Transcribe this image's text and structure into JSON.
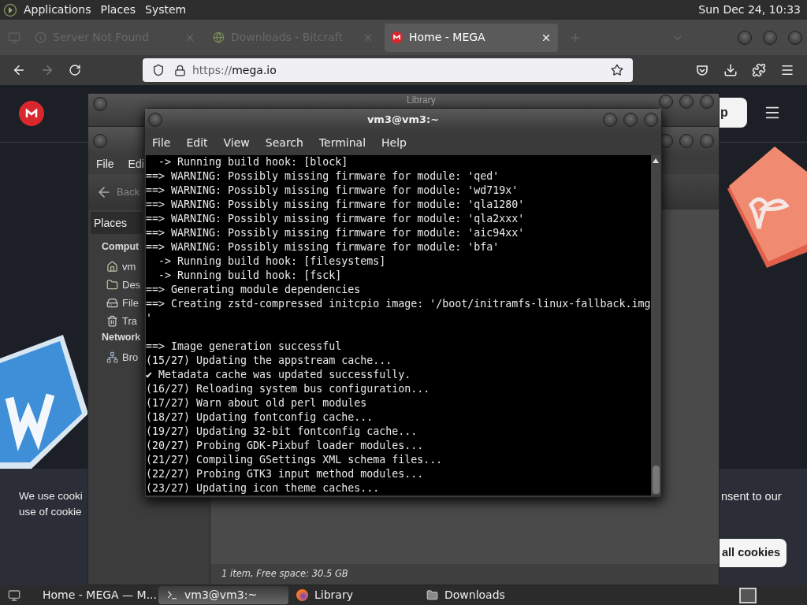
{
  "top_panel": {
    "menus": [
      "Applications",
      "Places",
      "System"
    ],
    "clock": "Sun Dec 24, 10:33"
  },
  "browser": {
    "tabs": [
      {
        "title": "Server Not Found",
        "kind": "info",
        "selected": false
      },
      {
        "title": "Downloads - Bitcraft",
        "kind": "site",
        "selected": false
      },
      {
        "title": "Home - MEGA",
        "kind": "mega",
        "selected": true
      }
    ],
    "forward_disabled": true,
    "url_scheme": "https://",
    "url_host": "mega.io"
  },
  "page": {
    "header_button": "p",
    "cookie_left": [
      "We use cooki",
      "use of cookie"
    ],
    "cookie_right": "nsent to our",
    "cookie_button": "all cookies"
  },
  "library_window": {
    "title": "Library"
  },
  "file_manager": {
    "menus": [
      "File",
      "Edi"
    ],
    "back": "Back",
    "sidebar_header": "Places",
    "sections": [
      {
        "title": "Comput",
        "items": [
          {
            "label": "vm",
            "kind": "home"
          },
          {
            "label": "Des",
            "kind": "desktop"
          },
          {
            "label": "File",
            "kind": "drive"
          },
          {
            "label": "Tra",
            "kind": "trash"
          }
        ]
      },
      {
        "title": "Network",
        "items": [
          {
            "label": "Bro",
            "kind": "network"
          }
        ]
      }
    ],
    "status": "1 item, Free space: 30.5 GB"
  },
  "terminal": {
    "title": "vm3@vm3:~",
    "menus": [
      "File",
      "Edit",
      "View",
      "Search",
      "Terminal",
      "Help"
    ],
    "blocks": [
      [
        "  -> Running build hook: [block]",
        "==> WARNING: Possibly missing firmware for module: 'qed'",
        "==> WARNING: Possibly missing firmware for module: 'wd719x'",
        "==> WARNING: Possibly missing firmware for module: 'qla1280'",
        "==> WARNING: Possibly missing firmware for module: 'qla2xxx'",
        "==> WARNING: Possibly missing firmware for module: 'aic94xx'",
        "==> WARNING: Possibly missing firmware for module: 'bfa'",
        "  -> Running build hook: [filesystems]",
        "  -> Running build hook: [fsck]",
        "==> Generating module dependencies",
        "==> Creating zstd-compressed initcpio image: '/boot/initramfs-linux-fallback.img",
        "'"
      ],
      [
        "==> Image generation successful",
        "(15/27) Updating the appstream cache...",
        "✔ Metadata cache was updated successfully.",
        "(16/27) Reloading system bus configuration...",
        "(17/27) Warn about old perl modules",
        "(18/27) Updating fontconfig cache...",
        "(19/27) Updating 32-bit fontconfig cache...",
        "(20/27) Probing GDK-Pixbuf loader modules...",
        "(21/27) Compiling GSettings XML schema files...",
        "(22/27) Probing GTK3 input method modules...",
        "(23/27) Updating icon theme caches..."
      ]
    ]
  },
  "taskbar": {
    "items": [
      {
        "label": "Home - MEGA — M...",
        "kind": "browser",
        "selected": false
      },
      {
        "label": "vm3@vm3:~",
        "kind": "terminal",
        "selected": true
      },
      {
        "label": "Library",
        "kind": "browser",
        "selected": false
      },
      {
        "label": "Downloads",
        "kind": "folder",
        "selected": false
      }
    ]
  }
}
